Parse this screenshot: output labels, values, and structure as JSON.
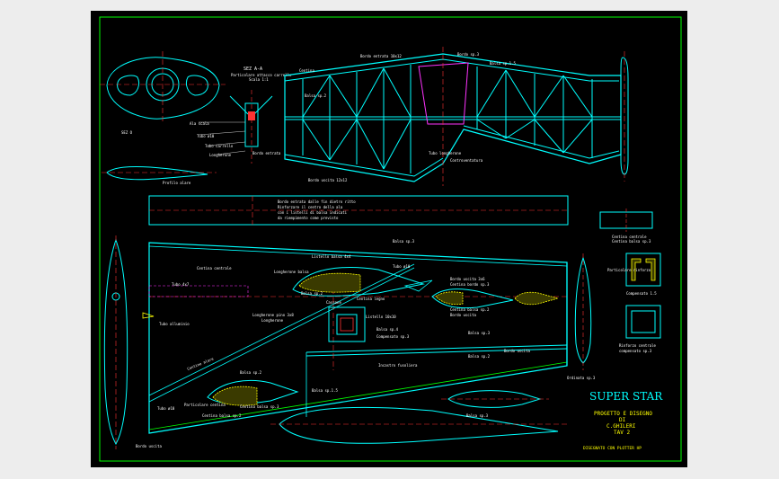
{
  "drawing": {
    "title": "SUPER STAR",
    "subtitle_1": "PROGETTO E DISEGNO",
    "subtitle_2": "DI",
    "subtitle_3": "C.GHILERI",
    "sheet": "TAV 2",
    "signature": "DISEGNATO CON PLOTTER HP"
  },
  "labels": {
    "sez_aa": "SEZ A-A",
    "sez_aa_note": "Particolare attacco carrello",
    "sez_aa_note2": "Scala 1:1",
    "sez_o": "SEZ O",
    "ala_scala": "Ala scala",
    "tubo": "Tubo ø10",
    "longherone": "Longherone",
    "bordo_entrata_wing": "Bordo entrata 10x12",
    "bordo_uscita_wing": "Bordo uscita 12x12",
    "centina": "Centina",
    "tubo_carrello": "Tubo carrello",
    "bordo_entrata": "Bordo entrata",
    "carrello": "Carrello 3 mm",
    "tubo_alluminio": "Tubo alluminio",
    "legno_balsa": "Balsa sp.2",
    "note_line1": "Bordo entrata dalle fin dietro ritto",
    "note_line2": "Rinforzare il centro della ala",
    "note_line3": "con i listelli di balsa indicati",
    "note_line4": "da riempimento come previsto",
    "centina_profilo": "Centina centrale",
    "centina_profilo2": "Centina balsa sp.3",
    "balsa_sp3": "Balsa sp.3",
    "listello_4x7": "Tubo 4x7",
    "centina_centrale": "Centina centrale",
    "incastro": "Incastro fusoliera",
    "particolare_1": "Particolare centina",
    "particolare_2": "Centina balsa sp.2",
    "cassone": "Cassone",
    "listello_10x10": "Listello 10x10",
    "balsa_4": "Balsa sp.4",
    "compensato": "Compensato sp.3",
    "particolare_3": "Particolare rinforzo",
    "particolare_4": "Compensato 1.5",
    "particolare_5": "Rinforzo centrale",
    "particolare_6": "compensato sp.3",
    "scala_longherone": "Longherone balsa",
    "listello_balsa": "Listello balsa 4x4",
    "balsa_sp2": "Balsa sp.2",
    "balsa_1_5": "Balsa sp.1.5",
    "centina_legno": "Centina legno",
    "longherone_pino": "Longherone pino 3x8",
    "bordo_uscita": "Bordo uscita",
    "bordo_uscita_2": "Bordo uscita 3x6",
    "centina_bordo": "Centina bordo sp.3",
    "bordo_uscita_3": "Bordo uscita",
    "centina_balsa": "Centina balsa sp.2",
    "centina_balsa_2": "Centina balsa sp.3",
    "profilo": "Profilo alare",
    "centine_alare": "Centine alare",
    "bordo_sp3": "Bordo sp.3",
    "tubo_longherone": "Tubo longherone",
    "contro": "Controventatura",
    "ordinata": "Ordinata sp.3"
  },
  "colors": {
    "frame_bg": "#000000",
    "border": "#00ff00",
    "structure": "#00ffff",
    "axis": "#ff3333",
    "text": "#ffffff",
    "title": "#00ffff",
    "credits": "#ffff00",
    "fill_hatch": "#ffff00",
    "magenta": "#ff33ff"
  }
}
